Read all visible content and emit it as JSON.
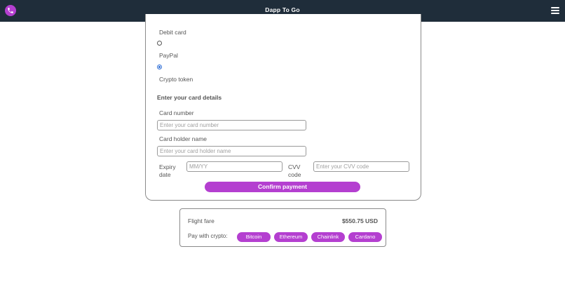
{
  "header": {
    "title": "Dapp To Go",
    "phone_icon": "phone-icon",
    "menu_icon": "hamburger-menu-icon"
  },
  "payment_methods": [
    {
      "label": "Debit card",
      "selected": false
    },
    {
      "label": "PayPal",
      "selected": true
    },
    {
      "label": "Crypto token",
      "selected": false
    }
  ],
  "card_details": {
    "title": "Enter your card details",
    "card_number_label": "Card number",
    "card_number_placeholder": "Enter your card number",
    "holder_label": "Card holder name",
    "holder_placeholder": "Enter your card holder name",
    "expiry_label_1": "Expiry",
    "expiry_label_2": "date",
    "expiry_placeholder": "MM/YY",
    "cvv_label_1": "CVV",
    "cvv_label_2": "code",
    "cvv_placeholder": "Enter your CVV code",
    "confirm_label": "Confirm payment"
  },
  "summary": {
    "fare_label": "Flight fare",
    "fare_value": "$550.75 USD",
    "crypto_label": "Pay with crypto:",
    "cryptos": [
      "Bitcoin",
      "Ethereum",
      "Chainlink",
      "Cardano"
    ]
  },
  "colors": {
    "accent": "#b43fd0",
    "header_bg": "#1f2d3a",
    "radio_checked": "#2f6fd6"
  }
}
